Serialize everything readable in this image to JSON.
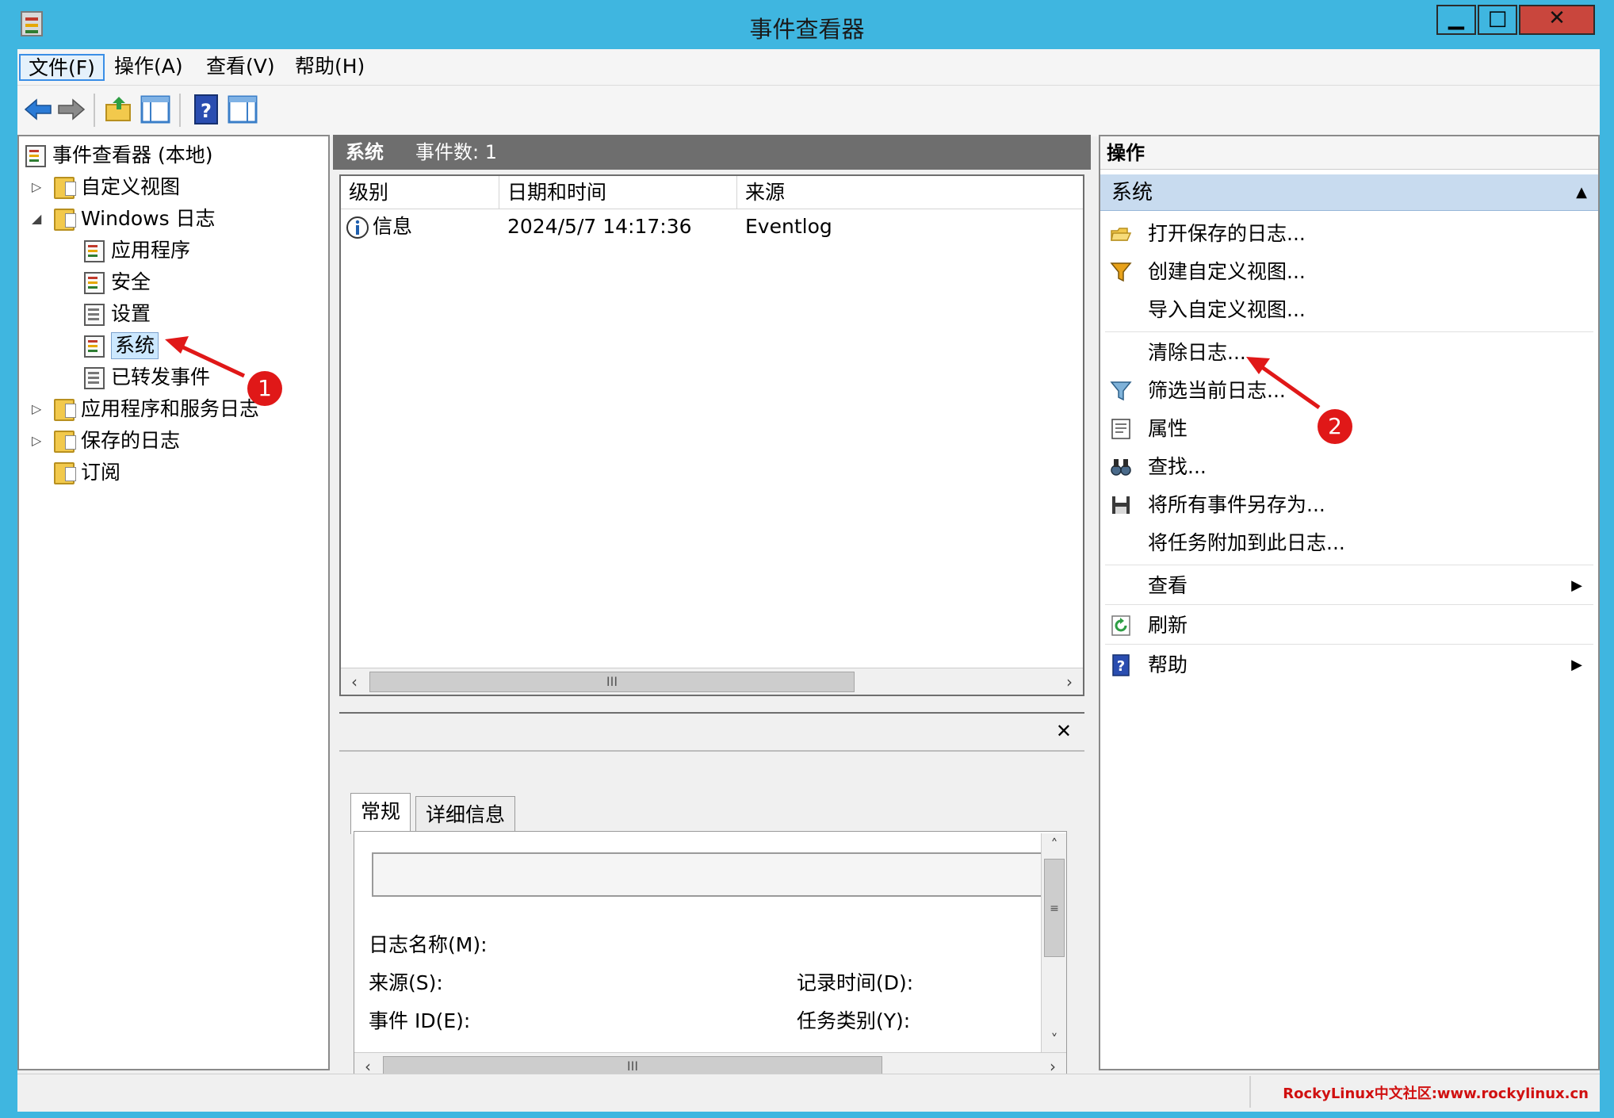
{
  "window": {
    "title": "事件查看器",
    "controls": {
      "minimize": "▁",
      "maximize": "□",
      "close": "✕"
    }
  },
  "menu": [
    "文件(F)",
    "操作(A)",
    "查看(V)",
    "帮助(H)"
  ],
  "tree": {
    "root": "事件查看器 (本地)",
    "custom_views": "自定义视图",
    "windows_logs": "Windows 日志",
    "application": "应用程序",
    "security": "安全",
    "setup": "设置",
    "system": "系统",
    "forwarded": "已转发事件",
    "app_service_logs": "应用程序和服务日志",
    "saved_logs": "保存的日志",
    "subscriptions": "订阅"
  },
  "middle": {
    "header_log": "系统",
    "header_count": "事件数: 1",
    "columns": [
      "级别",
      "日期和时间",
      "来源"
    ],
    "rows": [
      {
        "level": "信息",
        "datetime": "2024/5/7 14:17:36",
        "source": "Eventlog"
      }
    ],
    "scroll_thumb": "III"
  },
  "detail": {
    "close": "✕",
    "tabs": [
      "常规",
      "详细信息"
    ],
    "fields": {
      "log_name": "日志名称(M):",
      "source": "来源(S):",
      "event_id": "事件 ID(E):",
      "logged": "记录时间(D):",
      "task_category": "任务类别(Y):"
    },
    "vthumb": "≡",
    "hthumb": "III"
  },
  "actions": {
    "title": "操作",
    "section": "系统",
    "items": [
      {
        "label": "打开保存的日志...",
        "icon": "folder-open-icon"
      },
      {
        "label": "创建自定义视图...",
        "icon": "filter-icon"
      },
      {
        "label": "导入自定义视图...",
        "icon": ""
      },
      {
        "label": "清除日志...",
        "icon": ""
      },
      {
        "label": "筛选当前日志...",
        "icon": "filter-icon"
      },
      {
        "label": "属性",
        "icon": "properties-icon"
      },
      {
        "label": "查找...",
        "icon": "binoculars-icon"
      },
      {
        "label": "将所有事件另存为...",
        "icon": "save-icon"
      },
      {
        "label": "将任务附加到此日志...",
        "icon": ""
      },
      {
        "label": "查看",
        "icon": ""
      },
      {
        "label": "刷新",
        "icon": "refresh-icon"
      },
      {
        "label": "帮助",
        "icon": "help-icon"
      }
    ]
  },
  "annotations": [
    "1",
    "2"
  ],
  "watermark": "RockyLinux中文社区:www.rockylinux.cn",
  "colors": {
    "titlebar": "#3fb6e0",
    "selection": "#cce8ff",
    "annotation": "#e01818"
  }
}
